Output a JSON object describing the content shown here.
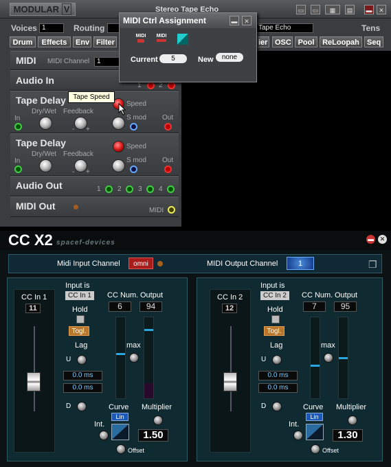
{
  "app": {
    "logo": "MODULAR",
    "logo_mark": "V",
    "window_title": "Stereo Tape Echo",
    "menu_left": "Tens",
    "voices_label": "Voices",
    "voices_value": "1",
    "routing_label": "Routing",
    "name_field": "Tape Echo",
    "tabs_left": [
      "Drum",
      "Effects",
      "Env",
      "Filter"
    ],
    "tabs_right": [
      "ier",
      "OSC",
      "Pool",
      "ReLoopah",
      "Seq"
    ],
    "title_icons": [
      "save-icon",
      "save-as-icon",
      "keyboard-icon",
      "pages-icon",
      "minimize-icon",
      "close-icon"
    ]
  },
  "rack": {
    "midi": {
      "title": "MIDI",
      "channel_label": "MIDI Channel",
      "channel_value": "1"
    },
    "audio_in": {
      "title": "Audio In",
      "ports": [
        "1",
        "2"
      ]
    },
    "tape_delay_1": {
      "title": "Tape Delay",
      "in": "In",
      "drywet": "Dry/Wet",
      "feedback": "Feedback",
      "speed": "Speed",
      "smod": "S mod",
      "out": "Out",
      "minus": "-",
      "plus": "+"
    },
    "tape_delay_2": {
      "title": "Tape Delay",
      "in": "In",
      "drywet": "Dry/Wet",
      "feedback": "Feedback",
      "speed": "Speed",
      "smod": "S mod",
      "out": "Out",
      "minus": "-",
      "plus": "+"
    },
    "audio_out": {
      "title": "Audio Out",
      "ports": [
        "1",
        "2",
        "3",
        "4"
      ]
    },
    "midi_out": {
      "title": "MIDI Out",
      "port": "MIDI"
    }
  },
  "tooltip": "Tape Speed",
  "popup": {
    "title": "MIDI Ctrl Assignment",
    "icon1": "MIDI",
    "icon2": "MIDI",
    "current_label": "Current",
    "current_value": "5",
    "new_label": "New",
    "new_value": "none"
  },
  "plugin": {
    "name": "CC X2",
    "maker": "spacef-devices",
    "midi_input_label": "Midi Input Channel",
    "midi_input_value": "omni",
    "midi_output_label": "MIDI Output Channel",
    "midi_output_value": "1",
    "channels": [
      {
        "cc_in_label": "CC In 1",
        "cc_in_value": "11",
        "input_is_label": "Input is",
        "input_is_value": "CC In 1",
        "hold_label": "Hold",
        "togl_label": "Togl.",
        "lag_label": "Lag",
        "u_label": "U",
        "d_label": "D",
        "lag_up": "0.0 ms",
        "lag_down": "0.0 ms",
        "cc_num_label": "CC Num.",
        "cc_num_value": "6",
        "output_label": "Output",
        "output_value": "94",
        "max_label": "max",
        "int_label": "Int.",
        "curve_label": "Curve",
        "curve_value": "Lin",
        "multiplier_label": "Multiplier",
        "multiplier_value": "1.50",
        "offset_label": "Offset",
        "slider_level": 0.3,
        "cc_level": 0.55,
        "out_level": 0.85
      },
      {
        "cc_in_label": "CC In 2",
        "cc_in_value": "12",
        "input_is_label": "Input is",
        "input_is_value": "CC In 2",
        "hold_label": "Hold",
        "togl_label": "Togl.",
        "lag_label": "Lag",
        "u_label": "U",
        "d_label": "D",
        "lag_up": "0.0 ms",
        "lag_down": "0.0 ms",
        "cc_num_label": "CC Num.",
        "cc_num_value": "7",
        "output_label": "Output",
        "output_value": "95",
        "max_label": "max",
        "int_label": "Int.",
        "curve_label": "Curve",
        "curve_value": "Lin",
        "multiplier_label": "Multiplier",
        "multiplier_value": "1.30",
        "offset_label": "Offset",
        "slider_level": 0.3,
        "cc_level": 0.4,
        "out_level": 0.5
      }
    ]
  }
}
